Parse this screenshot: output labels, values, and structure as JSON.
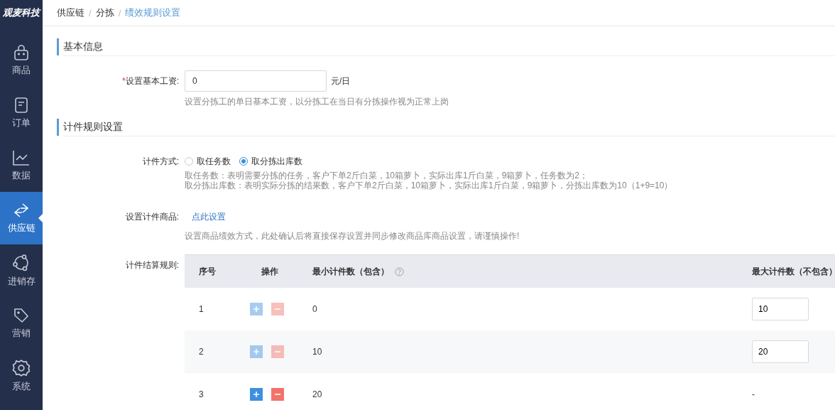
{
  "sidebar": {
    "logo": "观麦科技",
    "items": [
      {
        "label": "商品",
        "selected": false
      },
      {
        "label": "订单",
        "selected": false
      },
      {
        "label": "数据",
        "selected": false
      },
      {
        "label": "供应链",
        "selected": true
      },
      {
        "label": "进销存",
        "selected": false
      },
      {
        "label": "营销",
        "selected": false
      },
      {
        "label": "系统",
        "selected": false
      }
    ]
  },
  "breadcrumb": [
    {
      "label": "供应链",
      "current": false
    },
    {
      "separator": "/",
      "label": "分拣",
      "current": false
    },
    {
      "separator": "/",
      "label": "绩效规则设置",
      "current": true
    }
  ],
  "sections": [
    {
      "title": "基本信息",
      "fields": [
        {
          "kind": "input",
          "required_mark": "*",
          "label": "设置基本工资:",
          "value": "0",
          "unit": "元/日",
          "hints": [
            "设置分拣工的单日基本工资，以分拣工在当日有分拣操作视为正常上岗"
          ]
        }
      ]
    },
    {
      "title": "计件规则设置",
      "fields": [
        {
          "kind": "radio",
          "label": "计件方式:",
          "options": [
            {
              "label": "取任务数",
              "selected": false
            },
            {
              "label": "取分拣出库数",
              "selected": true
            }
          ],
          "hints": [
            "取任务数：表明需要分拣的任务，客户下单2斤白菜，10箱萝卜，实际出库1斤白菜，9箱萝卜，任务数为2；",
            "取分拣出库数：表明实际分拣的结果数，客户下单2斤白菜，10箱萝卜，实际出库1斤白菜，9箱萝卜，分拣出库数为10（1+9=10）"
          ]
        },
        {
          "kind": "link",
          "label": "设置计件商品:",
          "link": "点此设置",
          "hints": [
            "设置商品绩效方式，此处确认后将直接保存设置并同步修改商品库商品设置，请谨慎操作!"
          ]
        },
        {
          "kind": "table",
          "label": "计件结算规则:",
          "columns": [
            "序号",
            "操作",
            "最小计件数（包含）",
            "最大计件数（不包含）"
          ],
          "rows": [
            {
              "kind": "editable",
              "index": "1",
              "enabled": false,
              "min": "0",
              "max": "10"
            },
            {
              "kind": "editable",
              "index": "2",
              "enabled": false,
              "min": "10",
              "max": "20"
            },
            {
              "kind": "fixed",
              "index": "3",
              "enabled": true,
              "min": "20",
              "max": "-"
            }
          ]
        }
      ]
    }
  ]
}
